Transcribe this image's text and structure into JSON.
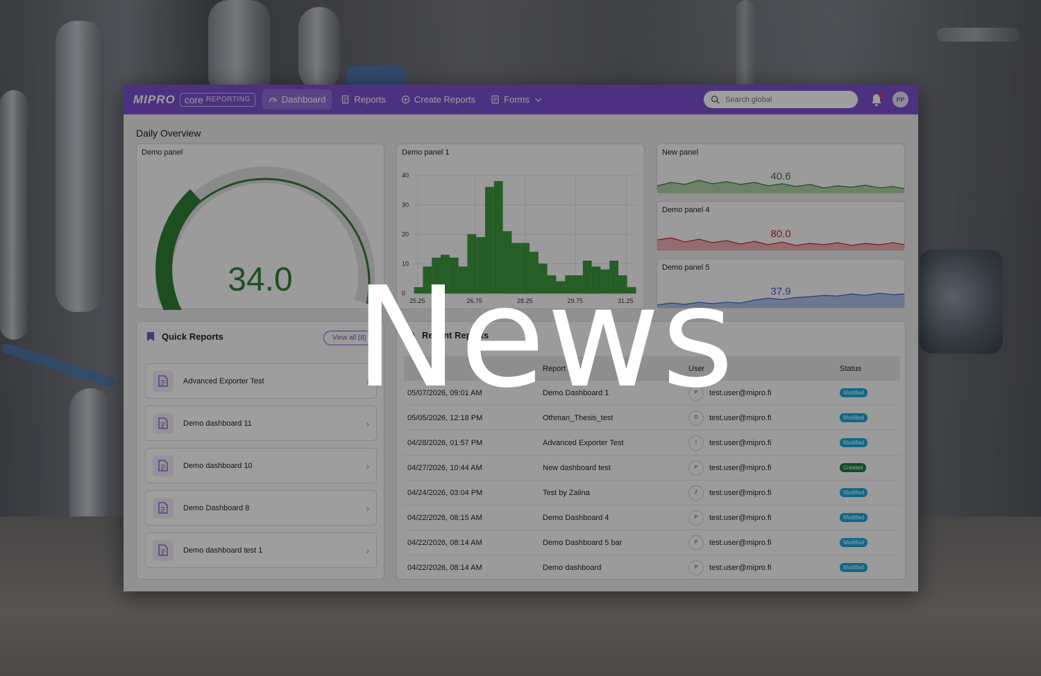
{
  "overlay": {
    "headline": "News"
  },
  "app": {
    "brand": {
      "logo": "MIPRO",
      "product": "core",
      "product_sub": "REPORTING"
    },
    "nav": [
      {
        "label": "Dashboard",
        "icon": "gauge-icon",
        "active": true
      },
      {
        "label": "Reports",
        "icon": "document-icon"
      },
      {
        "label": "Create Reports",
        "icon": "plus-circle-icon"
      },
      {
        "label": "Forms",
        "icon": "form-icon"
      }
    ],
    "search": {
      "placeholder": "Search global"
    },
    "user": {
      "initials": "PP"
    },
    "section_title": "Daily Overview",
    "colors": {
      "accent": "#7c4fd0",
      "green": "#2e7d32",
      "red": "#c62828",
      "blue": "#3a64c8",
      "modified": "#1aa7d9",
      "created": "#1b7f3a"
    }
  },
  "panels": {
    "gauge": {
      "title": "Demo panel",
      "value": "34.0",
      "fraction": 0.34
    },
    "histogram": {
      "title": "Demo panel 1"
    },
    "new_panel": {
      "title": "New panel",
      "value": "40.6"
    },
    "panel4": {
      "title": "Demo panel 4",
      "value": "80.0"
    },
    "panel5": {
      "title": "Demo panel 5",
      "value": "37.9"
    }
  },
  "chart_data": {
    "type": "bar",
    "title": "Demo panel 1",
    "x_ticks": [
      "25.25",
      "26.75",
      "28.25",
      "29.75",
      "31.25"
    ],
    "y_ticks": [
      "0",
      "10",
      "20",
      "30",
      "40"
    ],
    "ylim": [
      0,
      40
    ],
    "values": [
      2,
      9,
      12,
      13,
      12,
      9,
      20,
      19,
      36,
      38,
      21,
      17,
      17,
      14,
      10,
      6,
      4,
      6,
      6,
      11,
      9,
      8,
      11,
      6,
      2
    ],
    "grid": true
  },
  "quick_reports": {
    "title": "Quick Reports",
    "view_all": "View all (8)",
    "items": [
      "Advanced Exporter Test",
      "Demo dashboard 11",
      "Demo dashboard 10",
      "Demo Dashboard 8",
      "Demo dashboard test 1"
    ]
  },
  "recent_reports": {
    "title": "Recent Reports",
    "columns": [
      "Report Name",
      "User",
      "Status"
    ],
    "rows": [
      {
        "date": "05/07/2026, 09:01 AM",
        "name": "Demo Dashboard 1",
        "initial": "P",
        "user": "test.user@mipro.fi",
        "status": "Modified"
      },
      {
        "date": "05/05/2026, 12:18 PM",
        "name": "Othman_Thesis_test",
        "initial": "O",
        "user": "test.user@mipro.fi",
        "status": "Modified"
      },
      {
        "date": "04/28/2026, 01:57 PM",
        "name": "Advanced Exporter Test",
        "initial": "I",
        "user": "test.user@mipro.fi",
        "status": "Modified"
      },
      {
        "date": "04/27/2026, 10:44 AM",
        "name": "New dashboard test",
        "initial": "P",
        "user": "test.user@mipro.fi",
        "status": "Created"
      },
      {
        "date": "04/24/2026, 03:04 PM",
        "name": "Test by Zalina",
        "initial": "Z",
        "user": "test.user@mipro.fi",
        "status": "Modified"
      },
      {
        "date": "04/22/2026, 08:15 AM",
        "name": "Demo Dashboard 4",
        "initial": "P",
        "user": "test.user@mipro.fi",
        "status": "Modified"
      },
      {
        "date": "04/22/2026, 08:14 AM",
        "name": "Demo Dashboard 5 bar",
        "initial": "P",
        "user": "test.user@mipro.fi",
        "status": "Modified"
      },
      {
        "date": "04/22/2026, 08:14 AM",
        "name": "Demo dashboard",
        "initial": "P",
        "user": "test.user@mipro.fi",
        "status": "Modified"
      }
    ]
  }
}
